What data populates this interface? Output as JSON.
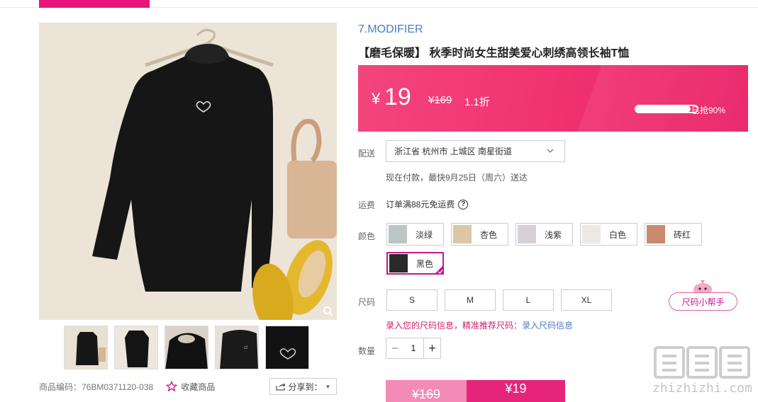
{
  "brand": "7.MODIFIER",
  "title": "【磨毛保暖】 秋季时尚女生甜美爱心刺绣高领长袖T恤",
  "price": {
    "symbol": "¥",
    "current": "19",
    "original": "¥169",
    "discount": "1.1折",
    "sold_label": "已抢90%",
    "sold_fraction": 0.9
  },
  "delivery": {
    "label": "配送",
    "address": "浙江省 杭州市 上城区 南星街道",
    "eta": "现在付款，最快9月25日（周六）送达"
  },
  "shipping": {
    "label": "运费",
    "text": "订单满88元免运费",
    "help_glyph": "?"
  },
  "color": {
    "label": "颜色",
    "options": [
      {
        "name": "淡绿",
        "swatch": "#b9c6c3"
      },
      {
        "name": "杏色",
        "swatch": "#d9c7a6"
      },
      {
        "name": "浅紫",
        "swatch": "#d8cfd8"
      },
      {
        "name": "白色",
        "swatch": "#ece9e4"
      },
      {
        "name": "砖红",
        "swatch": "#c98a6e"
      },
      {
        "name": "黑色",
        "swatch": "#2a2a2a"
      }
    ],
    "selected": "黑色"
  },
  "size": {
    "label": "尺码",
    "options": [
      "S",
      "M",
      "L",
      "XL"
    ],
    "helper": "尺码小帮手",
    "tip_prefix": "录入您的尺码信息，精准推荐尺码：",
    "tip_link": "录入尺码信息"
  },
  "quantity": {
    "label": "数量",
    "value": "1",
    "minus": "−",
    "plus": "+"
  },
  "buy": {
    "original": "¥169",
    "current": "¥19"
  },
  "meta": {
    "code": "商品编码：76BM0371120-038",
    "favorite": "收藏商品",
    "share": "分享到：",
    "share_caret": "▼"
  },
  "watermark": "zhizhizhi.com",
  "colors": {
    "accent": "#e5157a",
    "price_bg": "#ef2f6f",
    "link": "#4a7cc7"
  }
}
